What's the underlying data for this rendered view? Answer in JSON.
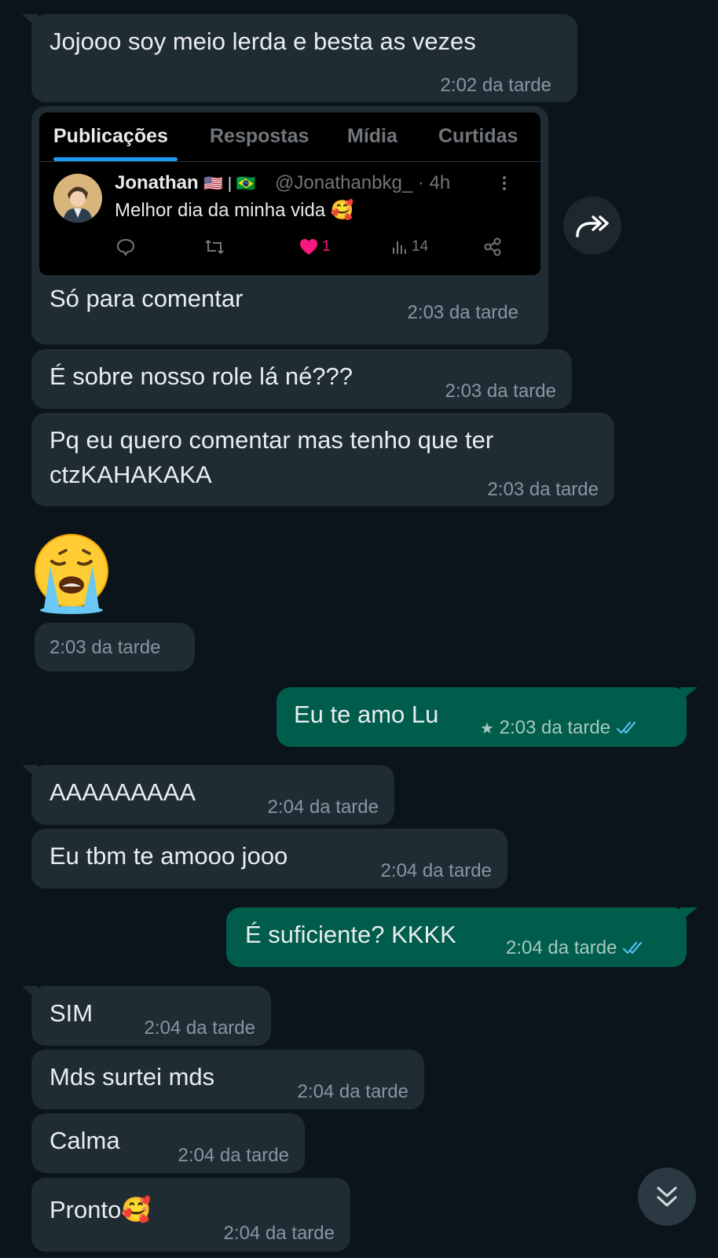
{
  "colors": {
    "background": "#0b141a",
    "incoming_bubble": "#202c33",
    "outgoing_bubble": "#005c4b",
    "read_ticks": "#53bdeb",
    "twitter_blue": "#1d9bf0",
    "like_pink": "#f91880"
  },
  "messages": [
    {
      "dir": "in",
      "text": "Jojooo soy meio lerda e besta as vezes",
      "time": "2:02 da tarde"
    },
    {
      "dir": "in",
      "type": "tweet_share",
      "text": "Só para comentar",
      "time": "2:03 da tarde",
      "tweet": {
        "tabs": [
          "Publicações",
          "Respostas",
          "Mídia",
          "Curtidas"
        ],
        "active_tab": "Publicações",
        "author_name": "Jonathan",
        "author_flags": "🇺🇸 | 🇧🇷",
        "handle_time": "@Jonathanbkg_ · 4h",
        "text": "Melhor dia da minha vida 🥰",
        "likes": "1",
        "views": "14",
        "icons": [
          "reply-icon",
          "retweet-icon",
          "heart-icon",
          "views-icon",
          "share-icon",
          "more-icon"
        ]
      }
    },
    {
      "dir": "in",
      "text": "É sobre nosso role lá né???",
      "time": "2:03 da tarde"
    },
    {
      "dir": "in",
      "text_lines": [
        "Pq eu quero comentar mas tenho que ter",
        "ctzKAHAKAKA"
      ],
      "time": "2:03 da tarde"
    },
    {
      "dir": "in",
      "type": "emoji",
      "emoji": "loudly-crying-face",
      "time": "2:03 da tarde"
    },
    {
      "dir": "out",
      "text": "Eu te amo Lu",
      "time": "2:03 da tarde",
      "starred": true,
      "status": "read"
    },
    {
      "dir": "in",
      "text": "AAAAAAAAA",
      "time": "2:04 da tarde"
    },
    {
      "dir": "in",
      "text": "Eu tbm te amooo jooo",
      "time": "2:04 da tarde"
    },
    {
      "dir": "out",
      "text": "É suficiente? KKKK",
      "time": "2:04 da tarde",
      "status": "read"
    },
    {
      "dir": "in",
      "text": "SIM",
      "time": "2:04 da tarde"
    },
    {
      "dir": "in",
      "text": "Mds surtei mds",
      "time": "2:04 da tarde"
    },
    {
      "dir": "in",
      "text": "Calma",
      "time": "2:04 da tarde"
    },
    {
      "dir": "in",
      "text": "Pronto🥰",
      "time": "2:04 da tarde"
    }
  ],
  "controls": {
    "forward_icon": "forward-icon",
    "scroll_down_icon": "double-chevron-down-icon"
  }
}
